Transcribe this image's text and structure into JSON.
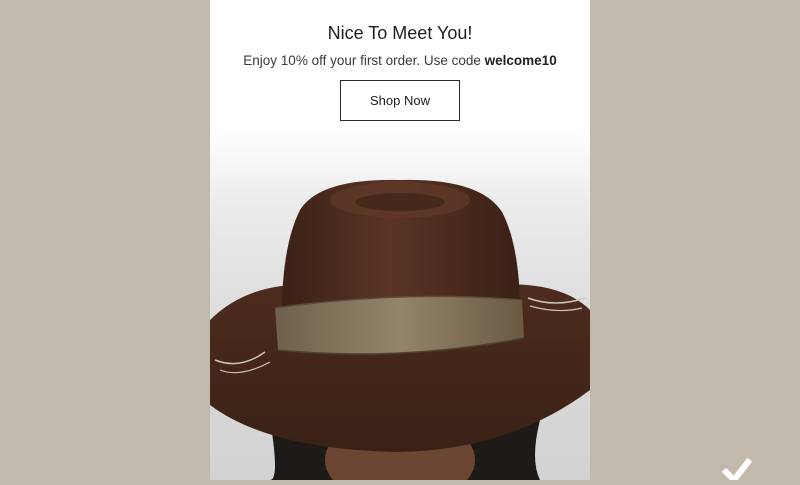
{
  "popup": {
    "title": "Nice To Meet You!",
    "subtitle_prefix": "Enjoy 10% off your first order. Use code ",
    "discount_code": "welcome10",
    "cta_label": "Shop Now"
  },
  "colors": {
    "page_background": "#c2b9ad",
    "popup_background": "#ffffff",
    "hat_felt": "#4a2a1c",
    "hat_band": "#8a7a62"
  },
  "icons": {
    "corner_logo": "checkmark-logo-icon"
  }
}
